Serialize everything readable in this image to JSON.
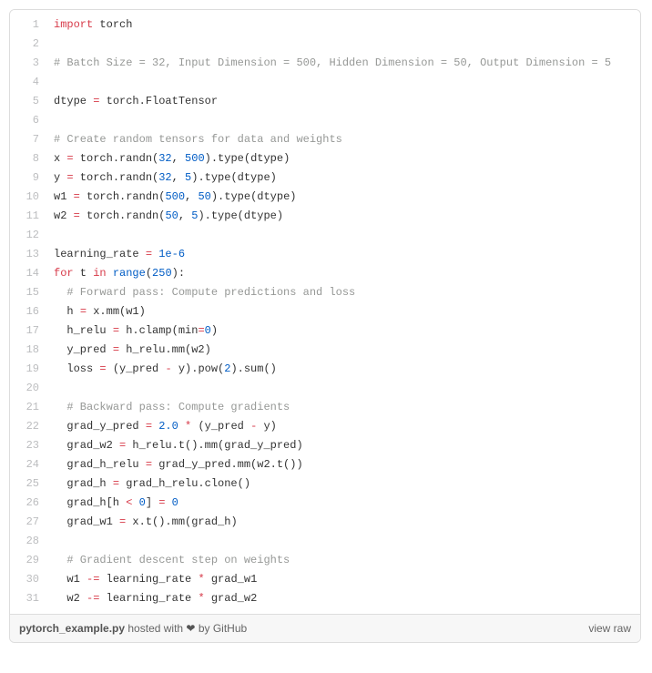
{
  "code": {
    "lines": [
      {
        "n": 1,
        "html": "<span class='kw'>import</span> <span class='param'>torch</span>"
      },
      {
        "n": 2,
        "html": ""
      },
      {
        "n": 3,
        "html": "<span class='comment'># Batch Size = 32, Input Dimension = 500, Hidden Dimension = 50, Output Dimension = 5</span>"
      },
      {
        "n": 4,
        "html": ""
      },
      {
        "n": 5,
        "html": "dtype <span class='kw'>=</span> torch.FloatTensor"
      },
      {
        "n": 6,
        "html": ""
      },
      {
        "n": 7,
        "html": "<span class='comment'># Create random tensors for data and weights</span>"
      },
      {
        "n": 8,
        "html": "x <span class='kw'>=</span> torch.randn(<span class='num'>32</span>, <span class='num'>500</span>).type(dtype)"
      },
      {
        "n": 9,
        "html": "y <span class='kw'>=</span> torch.randn(<span class='num'>32</span>, <span class='num'>5</span>).type(dtype)"
      },
      {
        "n": 10,
        "html": "w1 <span class='kw'>=</span> torch.randn(<span class='num'>500</span>, <span class='num'>50</span>).type(dtype)"
      },
      {
        "n": 11,
        "html": "w2 <span class='kw'>=</span> torch.randn(<span class='num'>50</span>, <span class='num'>5</span>).type(dtype)"
      },
      {
        "n": 12,
        "html": ""
      },
      {
        "n": 13,
        "html": "learning_rate <span class='kw'>=</span> <span class='num'>1e-6</span>"
      },
      {
        "n": 14,
        "html": "<span class='kw'>for</span> t <span class='kw'>in</span> <span class='num'>range</span>(<span class='num'>250</span>):"
      },
      {
        "n": 15,
        "html": "  <span class='comment'># Forward pass: Compute predictions and loss</span>"
      },
      {
        "n": 16,
        "html": "  h <span class='kw'>=</span> x.mm(w1)"
      },
      {
        "n": 17,
        "html": "  h_relu <span class='kw'>=</span> h.clamp(<span class='arg'>min</span><span class='kw'>=</span><span class='num'>0</span>)"
      },
      {
        "n": 18,
        "html": "  y_pred <span class='kw'>=</span> h_relu.mm(w2)"
      },
      {
        "n": 19,
        "html": "  loss <span class='kw'>=</span> (y_pred <span class='kw'>-</span> y).pow(<span class='num'>2</span>).sum()"
      },
      {
        "n": 20,
        "html": ""
      },
      {
        "n": 21,
        "html": "  <span class='comment'># Backward pass: Compute gradients</span>"
      },
      {
        "n": 22,
        "html": "  grad_y_pred <span class='kw'>=</span> <span class='num'>2.0</span> <span class='kw'>*</span> (y_pred <span class='kw'>-</span> y)"
      },
      {
        "n": 23,
        "html": "  grad_w2 <span class='kw'>=</span> h_relu.t().mm(grad_y_pred)"
      },
      {
        "n": 24,
        "html": "  grad_h_relu <span class='kw'>=</span> grad_y_pred.mm(w2.t())"
      },
      {
        "n": 25,
        "html": "  grad_h <span class='kw'>=</span> grad_h_relu.clone()"
      },
      {
        "n": 26,
        "html": "  grad_h[h <span class='kw'>&lt;</span> <span class='num'>0</span>] <span class='kw'>=</span> <span class='num'>0</span>"
      },
      {
        "n": 27,
        "html": "  grad_w1 <span class='kw'>=</span> x.t().mm(grad_h)"
      },
      {
        "n": 28,
        "html": ""
      },
      {
        "n": 29,
        "html": "  <span class='comment'># Gradient descent step on weights</span>"
      },
      {
        "n": 30,
        "html": "  w1 <span class='kw'>-=</span> learning_rate <span class='kw'>*</span> grad_w1"
      },
      {
        "n": 31,
        "html": "  w2 <span class='kw'>-=</span> learning_rate <span class='kw'>*</span> grad_w2"
      }
    ]
  },
  "footer": {
    "filename": "pytorch_example.py",
    "hosted_prefix": " hosted with ",
    "heart": "❤",
    "by_text": " by ",
    "github": "GitHub",
    "view_raw": "view raw"
  }
}
